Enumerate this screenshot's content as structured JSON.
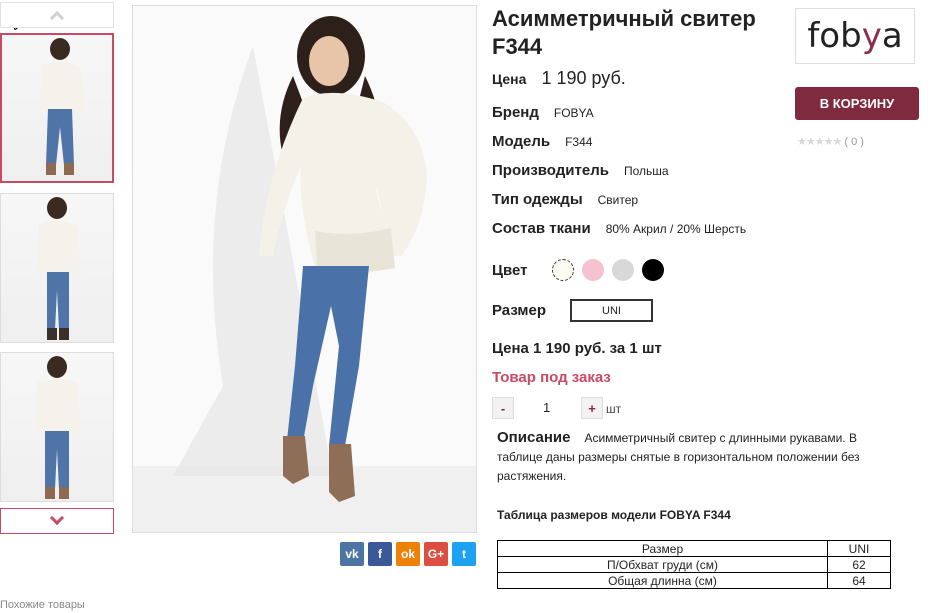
{
  "product": {
    "title": "Асимметричный свитер F344",
    "price_label": "Цена",
    "price": "1 190 руб.",
    "attributes": [
      {
        "label": "Бренд",
        "value": "FOBYA"
      },
      {
        "label": "Модель",
        "value": "F344"
      },
      {
        "label": "Производитель",
        "value": "Польша"
      },
      {
        "label": "Тип одежды",
        "value": "Свитер"
      },
      {
        "label": "Состав ткани",
        "value": "80% Акрил / 20% Шерсть"
      }
    ],
    "color_label": "Цвет",
    "colors": [
      "#fbfbf1",
      "#f7c2cf",
      "#d8d8d8",
      "#000000"
    ],
    "size_label": "Размер",
    "size_value": "UNI",
    "price_line": "Цена 1 190 руб. за 1 шт",
    "availability": "Товар под заказ",
    "quantity": {
      "minus": "-",
      "value": "1",
      "plus": "+",
      "unit": "шт"
    },
    "description_label": "Описание",
    "description": "Асимметричный свитер с длинными рукавами. В таблице даны размеры снятые в горизонтальном положении без растяжения.",
    "table_title": "Таблица размеров модели FOBYA  F344",
    "size_table": {
      "headers": [
        "Размер",
        "UNI"
      ],
      "rows": [
        [
          "П/Обхват груди (см)",
          "62"
        ],
        [
          "Общая длинна (см)",
          "64"
        ]
      ]
    }
  },
  "brand_logo": {
    "text_pre": "fob",
    "text_y": "y",
    "text_post": "a",
    "accent": "#8b2d4c"
  },
  "cart_button": "В КОРЗИНУ",
  "rating": {
    "stars": "★★★★★",
    "count": "( 0 )"
  },
  "social": [
    "vk",
    "f",
    "ok",
    "G+",
    "t"
  ],
  "similar_label": "Похожие товары",
  "colors": {
    "accent": "#c94a63",
    "button": "#7f2a3f"
  }
}
